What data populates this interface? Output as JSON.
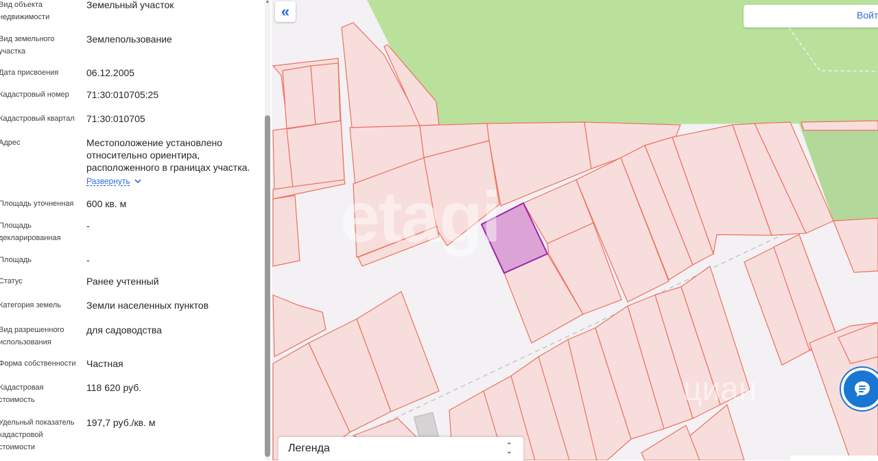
{
  "properties": [
    {
      "label": "Вид объекта недвижимости",
      "value": "Земельный участок"
    },
    {
      "label": "Вид земельного участка",
      "value": "Землепользование"
    },
    {
      "label": "Дата присвоения",
      "value": "06.12.2005"
    },
    {
      "label": "Кадастровый номер",
      "value": "71:30:010705:25"
    },
    {
      "label": "Кадастровый квартал",
      "value": "71:30:010705"
    },
    {
      "label": "Адрес",
      "value": "Местоположение установлено относительно ориентира, расположенного в границах участка."
    },
    {
      "label": "Площадь уточненная",
      "value": "600 кв. м"
    },
    {
      "label": "Площадь декларированная",
      "value": "-"
    },
    {
      "label": "Площадь",
      "value": "-"
    },
    {
      "label": "Статус",
      "value": "Ранее учтенный"
    },
    {
      "label": "Категория земель",
      "value": "Земли населенных пунктов"
    },
    {
      "label": "Вид разрешенного использования",
      "value": "для садоводства"
    },
    {
      "label": "Форма собственности",
      "value": "Частная"
    },
    {
      "label": "Кадастровая стоимость",
      "value": "118 620 руб."
    },
    {
      "label": "Удельный показатель кадастровой стоимости",
      "value": "197,7 руб./кв. м"
    }
  ],
  "address_expand_label": "Развернуть",
  "map": {
    "login_label": "Войти",
    "legend_label": "Легенда",
    "watermark_left": "etagi",
    "watermark_right": "циан",
    "colors": {
      "parcel_fill": "#f7dedd",
      "parcel_stroke": "#ef6f5c",
      "selected_fill": "#dca4d6",
      "selected_stroke": "#a020b0",
      "forest": "#b9e19c",
      "chat": "#1976d2"
    }
  }
}
